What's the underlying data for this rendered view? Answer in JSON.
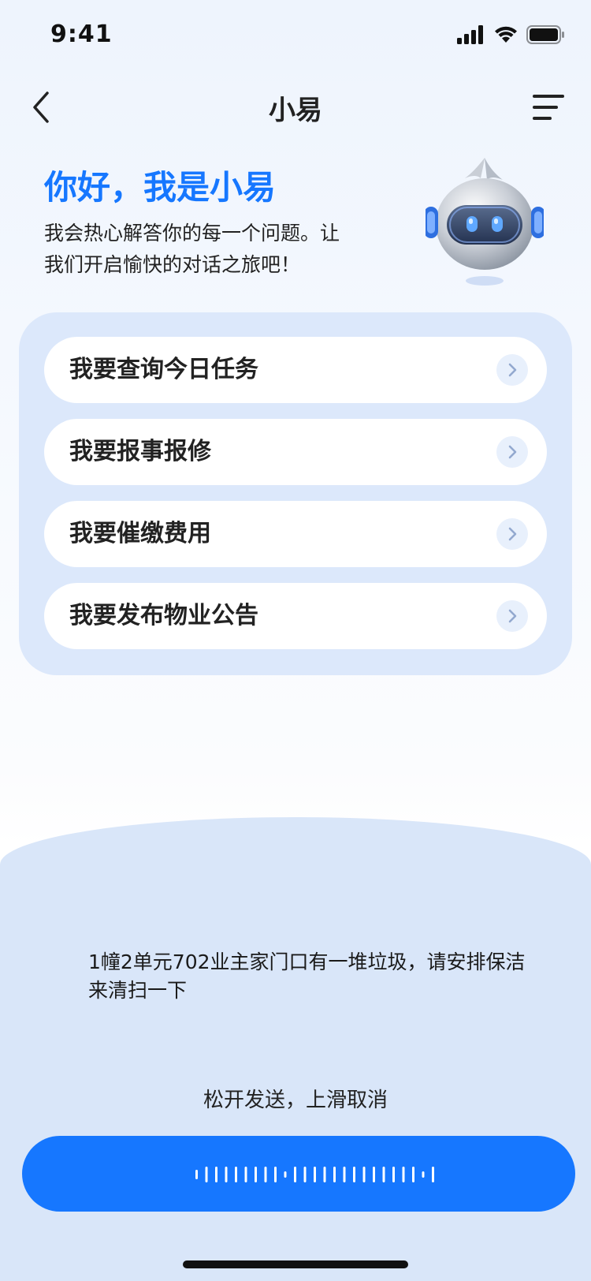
{
  "status": {
    "time": "9:41"
  },
  "nav": {
    "title": "小易"
  },
  "greeting": {
    "title": "你好，我是小易",
    "subtitle_line1": "我会热心解答你的每一个问题。让",
    "subtitle_line2": "我们开启愉快的对话之旅吧！"
  },
  "quick_actions": [
    {
      "label": "我要查询今日任务"
    },
    {
      "label": "我要报事报修"
    },
    {
      "label": "我要催缴费用"
    },
    {
      "label": "我要发布物业公告"
    }
  ],
  "voice": {
    "transcript": "1幢2单元702业主家门口有一堆垃圾，请安排保洁来清扫一下",
    "hint": "松开发送，上滑取消"
  },
  "colors": {
    "accent": "#1677ff",
    "panel": "#dce8fb",
    "sheet": "#d9e6f9"
  },
  "icons": {
    "back": "chevron-left-icon",
    "menu": "menu-lines-icon",
    "arrow": "chevron-right-icon",
    "signal": "cellular-signal-icon",
    "wifi": "wifi-icon",
    "battery": "battery-icon"
  }
}
